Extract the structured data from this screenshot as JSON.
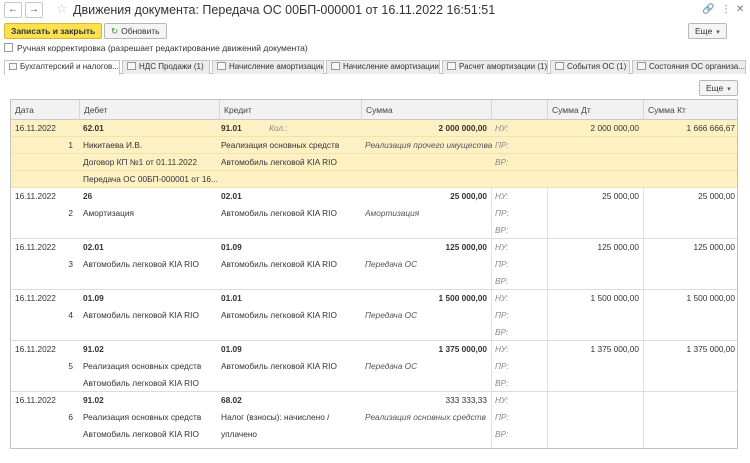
{
  "window": {
    "title": "Движения документа: Передача ОС 00БП-000001 от 16.11.2022 16:51:51",
    "link_icon": "🔗",
    "more_icon": "⋮",
    "close_icon": "✕"
  },
  "nav": {
    "back": "←",
    "forward": "→",
    "star": "☆"
  },
  "toolbar": {
    "save_close": "Записать и закрыть",
    "refresh": "Обновить",
    "refresh_icon": "↻",
    "more": "Еще",
    "caret": "▾"
  },
  "manual_correction": "Ручная корректировка (разрешает редактирование движений документа)",
  "tabs": [
    "Бухгалтерский и налогов...",
    "НДС Продажи (1)",
    "Начисление амортизации...",
    "Начисление амортизации...",
    "Расчет амортизации (1)",
    "События ОС (1)",
    "Состояния ОС организа..."
  ],
  "grid_more": "Еще",
  "columns": {
    "date": "Дата",
    "debit": "Дебет",
    "credit": "Кредит",
    "amount": "Сумма",
    "amount_dt": "Сумма Дт",
    "amount_kt": "Сумма Кт"
  },
  "records": [
    {
      "date": "16.11.2022",
      "num": "1",
      "debit": [
        "62.01",
        "Никитаева И.В.",
        "Договор КП №1 от 01.11.2022",
        "Передача ОС 00БП-000001 от 16..."
      ],
      "credit": [
        "91.01",
        "Реализация основных средств",
        "Автомобиль легковой KIA RIO"
      ],
      "qty_label": "Кол.:",
      "amount": "2 000 000,00",
      "content": "Реализация прочего имущества",
      "nu": "НУ:",
      "pr": "ПР:",
      "vr": "ВР:",
      "sum_dt": "2 000 000,00",
      "sum_kt": "1 666 666,67"
    },
    {
      "date": "16.11.2022",
      "num": "2",
      "debit": [
        "26",
        "Амортизация"
      ],
      "credit": [
        "02.01",
        "Автомобиль легковой KIA RIO"
      ],
      "amount": "25 000,00",
      "content": "Амортизация",
      "nu": "НУ:",
      "pr": "ПР:",
      "vr": "ВР:",
      "sum_dt": "25 000,00",
      "sum_kt": "25 000,00"
    },
    {
      "date": "16.11.2022",
      "num": "3",
      "debit": [
        "02.01",
        "Автомобиль легковой KIA RIO"
      ],
      "credit": [
        "01.09",
        "Автомобиль легковой KIA RIO"
      ],
      "amount": "125 000,00",
      "content": "Передача ОС",
      "nu": "НУ:",
      "pr": "ПР:",
      "vr": "ВР:",
      "sum_dt": "125 000,00",
      "sum_kt": "125 000,00"
    },
    {
      "date": "16.11.2022",
      "num": "4",
      "debit": [
        "01.09",
        "Автомобиль легковой KIA RIO"
      ],
      "credit": [
        "01.01",
        "Автомобиль легковой KIA RIO"
      ],
      "amount": "1 500 000,00",
      "content": "Передача ОС",
      "nu": "НУ:",
      "pr": "ПР:",
      "vr": "ВР:",
      "sum_dt": "1 500 000,00",
      "sum_kt": "1 500 000,00"
    },
    {
      "date": "16.11.2022",
      "num": "5",
      "debit": [
        "91.02",
        "Реализация основных средств",
        "Автомобиль легковой KIA RIO"
      ],
      "credit": [
        "01.09",
        "Автомобиль легковой KIA RIO"
      ],
      "amount": "1 375 000,00",
      "content": "Передача ОС",
      "nu": "НУ:",
      "pr": "ПР:",
      "vr": "ВР:",
      "sum_dt": "1 375 000,00",
      "sum_kt": "1 375 000,00"
    },
    {
      "date": "16.11.2022",
      "num": "6",
      "debit": [
        "91.02",
        "Реализация основных средств",
        "Автомобиль легковой KIA RIO"
      ],
      "credit": [
        "68.02",
        "Налог (взносы): начислено /",
        "уплачено"
      ],
      "amount": "333 333,33",
      "content": "Реализация основных средств",
      "nu": "НУ:",
      "pr": "ПР:",
      "vr": "ВР:",
      "sum_dt": "",
      "sum_kt": ""
    }
  ]
}
